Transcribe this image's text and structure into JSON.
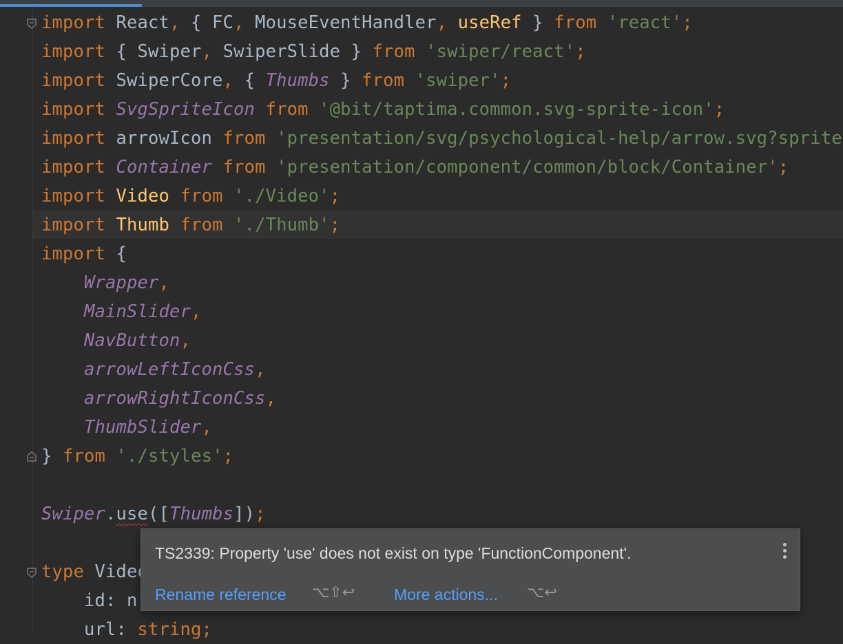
{
  "editor": {
    "lines": [
      [
        {
          "t": "import",
          "c": "kw"
        },
        {
          "t": " React",
          "c": "fn"
        },
        {
          "t": ",",
          "c": "kw"
        },
        {
          "t": " { FC",
          "c": "fn"
        },
        {
          "t": ",",
          "c": "kw"
        },
        {
          "t": " MouseEventHandler",
          "c": "fn"
        },
        {
          "t": ",",
          "c": "kw"
        },
        {
          "t": " ",
          "c": "fn"
        },
        {
          "t": "useRef",
          "c": "def"
        },
        {
          "t": " } ",
          "c": "fn"
        },
        {
          "t": "from",
          "c": "kw"
        },
        {
          "t": " ",
          "c": "fn"
        },
        {
          "t": "'react'",
          "c": "str"
        },
        {
          "t": ";",
          "c": "kw"
        }
      ],
      [
        {
          "t": "import",
          "c": "kw"
        },
        {
          "t": " { Swiper",
          "c": "fn"
        },
        {
          "t": ",",
          "c": "kw"
        },
        {
          "t": " SwiperSlide } ",
          "c": "fn"
        },
        {
          "t": "from",
          "c": "kw"
        },
        {
          "t": " ",
          "c": "fn"
        },
        {
          "t": "'swiper/react'",
          "c": "str"
        },
        {
          "t": ";",
          "c": "kw"
        }
      ],
      [
        {
          "t": "import",
          "c": "kw"
        },
        {
          "t": " SwiperCore",
          "c": "fn"
        },
        {
          "t": ",",
          "c": "kw"
        },
        {
          "t": " { ",
          "c": "fn"
        },
        {
          "t": "Thumbs",
          "c": "cls"
        },
        {
          "t": " } ",
          "c": "fn"
        },
        {
          "t": "from",
          "c": "kw"
        },
        {
          "t": " ",
          "c": "fn"
        },
        {
          "t": "'swiper'",
          "c": "str"
        },
        {
          "t": ";",
          "c": "kw"
        }
      ],
      [
        {
          "t": "import",
          "c": "kw"
        },
        {
          "t": " ",
          "c": "fn"
        },
        {
          "t": "SvgSpriteIcon",
          "c": "cls"
        },
        {
          "t": " ",
          "c": "fn"
        },
        {
          "t": "from",
          "c": "kw"
        },
        {
          "t": " ",
          "c": "fn"
        },
        {
          "t": "'@bit/taptima.common.svg-sprite-icon'",
          "c": "str"
        },
        {
          "t": ";",
          "c": "kw"
        }
      ],
      [
        {
          "t": "import",
          "c": "kw"
        },
        {
          "t": " arrowIcon ",
          "c": "fn"
        },
        {
          "t": "from",
          "c": "kw"
        },
        {
          "t": " ",
          "c": "fn"
        },
        {
          "t": "'presentation/svg/psychological-help/arrow.svg?sprite'",
          "c": "str"
        },
        {
          "t": ";",
          "c": "kw"
        }
      ],
      [
        {
          "t": "import",
          "c": "kw"
        },
        {
          "t": " ",
          "c": "fn"
        },
        {
          "t": "Container",
          "c": "cls"
        },
        {
          "t": " ",
          "c": "fn"
        },
        {
          "t": "from",
          "c": "kw"
        },
        {
          "t": " ",
          "c": "fn"
        },
        {
          "t": "'presentation/component/common/block/Container'",
          "c": "str"
        },
        {
          "t": ";",
          "c": "kw"
        }
      ],
      [
        {
          "t": "import",
          "c": "kw"
        },
        {
          "t": " ",
          "c": "fn"
        },
        {
          "t": "Video",
          "c": "def"
        },
        {
          "t": " ",
          "c": "fn"
        },
        {
          "t": "from",
          "c": "kw"
        },
        {
          "t": " ",
          "c": "fn"
        },
        {
          "t": "'./Video'",
          "c": "str"
        },
        {
          "t": ";",
          "c": "kw"
        }
      ],
      [
        {
          "t": "import",
          "c": "kw"
        },
        {
          "t": " ",
          "c": "fn"
        },
        {
          "t": "Thumb",
          "c": "def"
        },
        {
          "t": " ",
          "c": "fn"
        },
        {
          "t": "from",
          "c": "kw"
        },
        {
          "t": " ",
          "c": "fn"
        },
        {
          "t": "'./Thumb'",
          "c": "str"
        },
        {
          "t": ";",
          "c": "kw"
        }
      ],
      [
        {
          "t": "import",
          "c": "kw"
        },
        {
          "t": " {",
          "c": "fn"
        }
      ],
      [
        {
          "t": "    ",
          "c": "fn"
        },
        {
          "t": "Wrapper",
          "c": "cls"
        },
        {
          "t": ",",
          "c": "kw"
        }
      ],
      [
        {
          "t": "    ",
          "c": "fn"
        },
        {
          "t": "MainSlider",
          "c": "cls"
        },
        {
          "t": ",",
          "c": "kw"
        }
      ],
      [
        {
          "t": "    ",
          "c": "fn"
        },
        {
          "t": "NavButton",
          "c": "cls"
        },
        {
          "t": ",",
          "c": "kw"
        }
      ],
      [
        {
          "t": "    ",
          "c": "fn"
        },
        {
          "t": "arrowLeftIconCss",
          "c": "cls"
        },
        {
          "t": ",",
          "c": "kw"
        }
      ],
      [
        {
          "t": "    ",
          "c": "fn"
        },
        {
          "t": "arrowRightIconCss",
          "c": "cls"
        },
        {
          "t": ",",
          "c": "kw"
        }
      ],
      [
        {
          "t": "    ",
          "c": "fn"
        },
        {
          "t": "ThumbSlider",
          "c": "cls"
        },
        {
          "t": ",",
          "c": "kw"
        }
      ],
      [
        {
          "t": "} ",
          "c": "fn"
        },
        {
          "t": "from",
          "c": "kw"
        },
        {
          "t": " ",
          "c": "fn"
        },
        {
          "t": "'./styles'",
          "c": "str"
        },
        {
          "t": ";",
          "c": "kw"
        }
      ],
      [],
      [
        {
          "t": "Swiper",
          "c": "cls"
        },
        {
          "t": ".",
          "c": "fn"
        },
        {
          "t": "use",
          "c": "fn squig"
        },
        {
          "t": "([",
          "c": "fn"
        },
        {
          "t": "Thumbs",
          "c": "cls"
        },
        {
          "t": "])",
          "c": "fn"
        },
        {
          "t": ";",
          "c": "kw"
        }
      ],
      [],
      [
        {
          "t": "type",
          "c": "kw"
        },
        {
          "t": " Video",
          "c": "fn"
        }
      ],
      [
        {
          "t": "    id: n",
          "c": "fn"
        }
      ],
      [
        {
          "t": "    url: ",
          "c": "fn"
        },
        {
          "t": "string",
          "c": "kw"
        },
        {
          "t": ";",
          "c": "kw"
        }
      ]
    ],
    "highlighted_line": 8
  },
  "popup": {
    "message": "TS2339: Property 'use' does not exist on type 'FunctionComponent'.",
    "rename_label": "Rename reference",
    "rename_shortcut": "⌥⇧↩",
    "more_label": "More actions...",
    "more_shortcut": "⌥↩"
  },
  "colors": {
    "background": "#2b2b2b",
    "keyword": "#cc7832",
    "string": "#6a8759",
    "class": "#9876aa",
    "definition": "#ffc66d",
    "text": "#a9b7c6",
    "link": "#589df6"
  }
}
